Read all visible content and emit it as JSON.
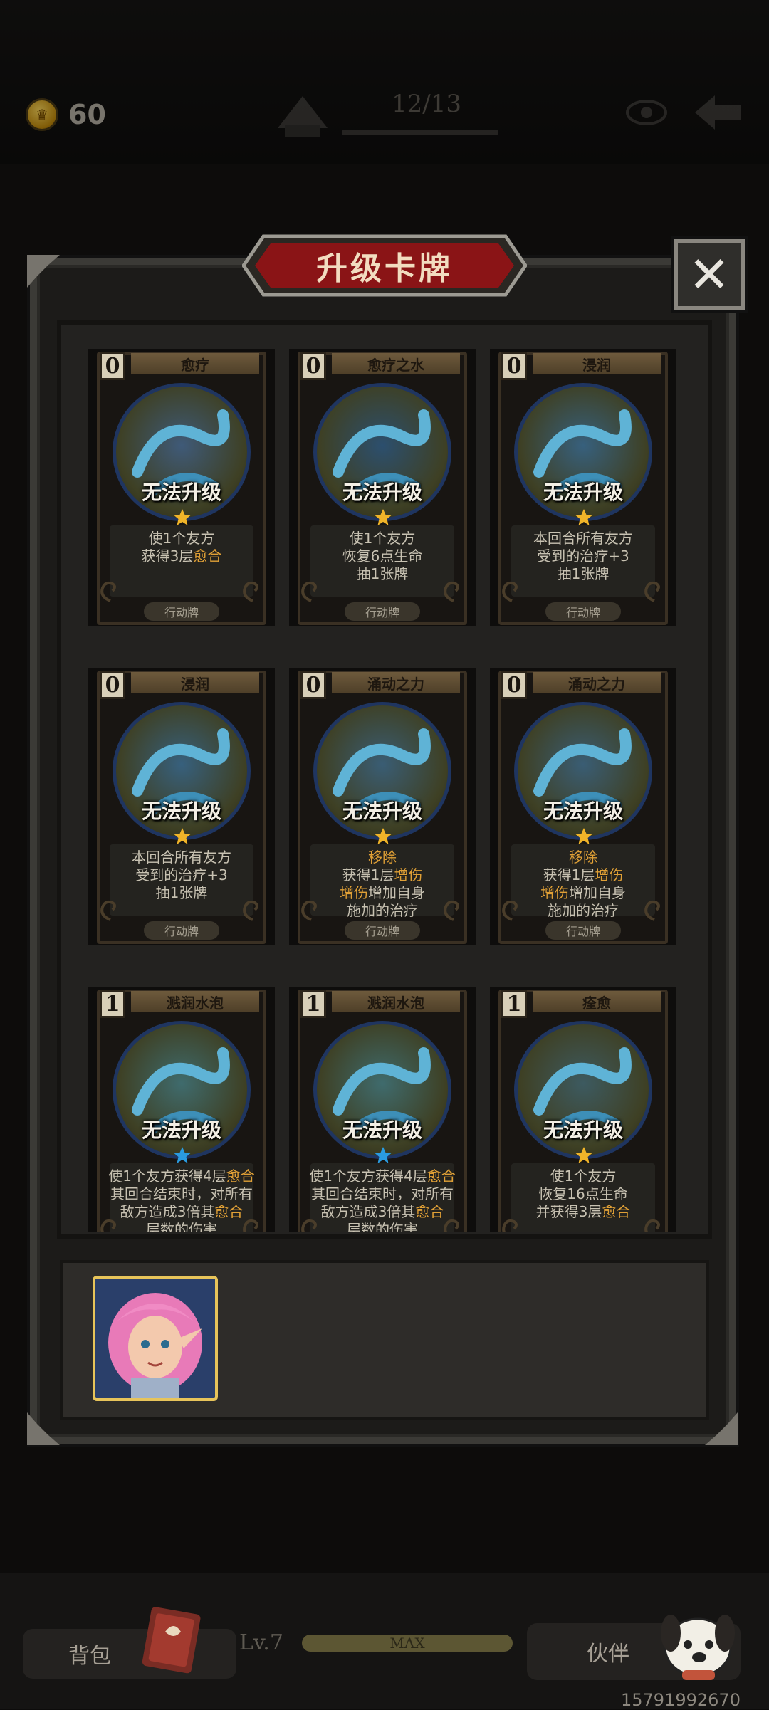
{
  "top": {
    "coins": "60",
    "level_progress": "12/13"
  },
  "modal": {
    "title": "升级卡牌",
    "close_icon": "close-icon"
  },
  "cards": [
    {
      "cost": "0",
      "name": "愈疗",
      "lock": "无法升级",
      "star": "gold",
      "desc": [
        [
          "使1个友方",
          ""
        ],
        [
          "获得3层",
          "愈合"
        ]
      ],
      "type": "行动牌"
    },
    {
      "cost": "0",
      "name": "愈疗之水",
      "lock": "无法升级",
      "star": "gold",
      "desc": [
        [
          "使1个友方",
          ""
        ],
        [
          "恢复6点生命",
          ""
        ],
        [
          "抽1张牌",
          ""
        ]
      ],
      "type": "行动牌"
    },
    {
      "cost": "0",
      "name": "浸润",
      "lock": "无法升级",
      "star": "gold",
      "desc": [
        [
          "本回合所有友方",
          ""
        ],
        [
          "受到的治疗+3",
          ""
        ],
        [
          "抽1张牌",
          ""
        ]
      ],
      "type": "行动牌"
    },
    {
      "cost": "0",
      "name": "浸润",
      "lock": "无法升级",
      "star": "gold",
      "desc": [
        [
          "本回合所有友方",
          ""
        ],
        [
          "受到的治疗+3",
          ""
        ],
        [
          "抽1张牌",
          ""
        ]
      ],
      "type": "行动牌"
    },
    {
      "cost": "0",
      "name": "涌动之力",
      "lock": "无法升级",
      "star": "gold",
      "desc": [
        [
          "",
          "移除"
        ],
        [
          "获得1层",
          "增伤"
        ],
        [
          "",
          "增伤",
          "增加自身"
        ],
        [
          "施加的治疗",
          ""
        ]
      ],
      "type": "行动牌"
    },
    {
      "cost": "0",
      "name": "涌动之力",
      "lock": "无法升级",
      "star": "gold",
      "desc": [
        [
          "",
          "移除"
        ],
        [
          "获得1层",
          "增伤"
        ],
        [
          "",
          "增伤",
          "增加自身"
        ],
        [
          "施加的治疗",
          ""
        ]
      ],
      "type": "行动牌"
    },
    {
      "cost": "1",
      "name": "溅润水泡",
      "lock": "无法升级",
      "star": "blue",
      "desc": [
        [
          "使1个友方获得4层",
          "愈合"
        ],
        [
          "其回合结束时，对所有",
          ""
        ],
        [
          "敌方造成3倍其",
          "愈合"
        ],
        [
          "层数的伤害",
          ""
        ]
      ],
      "type": ""
    },
    {
      "cost": "1",
      "name": "溅润水泡",
      "lock": "无法升级",
      "star": "blue",
      "desc": [
        [
          "使1个友方获得4层",
          "愈合"
        ],
        [
          "其回合结束时，对所有",
          ""
        ],
        [
          "敌方造成3倍其",
          "愈合"
        ],
        [
          "层数的伤害",
          ""
        ]
      ],
      "type": ""
    },
    {
      "cost": "1",
      "name": "痊愈",
      "lock": "无法升级",
      "star": "gold",
      "desc": [
        [
          "使1个友方",
          ""
        ],
        [
          "恢复16点生命",
          ""
        ],
        [
          "并获得3层",
          "愈合"
        ]
      ],
      "type": ""
    }
  ],
  "bottom": {
    "bag_label": "背包",
    "level_label": "Lv.7",
    "exp_label": "MAX",
    "partner_label": "伙伴",
    "footer_id": "15791992670"
  },
  "colors": {
    "highlight": "#e0a036",
    "gold_star": "#f0b429",
    "blue_star": "#2a9be0",
    "banner_red": "#8a1416"
  }
}
